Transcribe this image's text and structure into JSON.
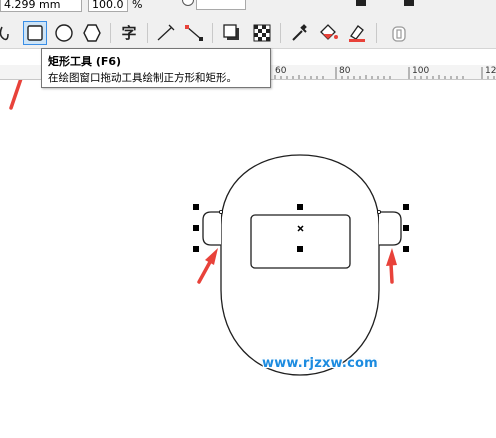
{
  "propbar": {
    "width_value": "4.299 mm",
    "scale_value": "100.0",
    "scale_unit": "%"
  },
  "toolbar": {
    "items": [
      {
        "icon": "freehand-curve-icon"
      },
      {
        "icon": "rectangle-tool-icon",
        "active": true
      },
      {
        "icon": "ellipse-tool-icon"
      },
      {
        "icon": "polygon-tool-icon"
      },
      {
        "icon": "text-tool-icon",
        "label": "字"
      },
      {
        "icon": "parallel-dimension-icon"
      },
      {
        "icon": "connector-tool-icon"
      },
      {
        "icon": "drop-shadow-icon"
      },
      {
        "icon": "transparency-icon"
      },
      {
        "icon": "eyedropper-icon"
      },
      {
        "icon": "interactive-fill-icon"
      },
      {
        "icon": "smart-fill-icon"
      },
      {
        "icon": "lock-icon"
      }
    ]
  },
  "tooltip": {
    "title": "矩形工具 (F6)",
    "description": "在绘图窗口拖动工具绘制正方形和矩形。"
  },
  "ruler": {
    "labels": [
      "60",
      "80",
      "100",
      "12"
    ]
  },
  "watermark": {
    "text": "www.rjzxw.com"
  },
  "colors": {
    "accent": "#3a8ee6",
    "arrow": "#e8423a",
    "watermark": "#1b8be0"
  }
}
